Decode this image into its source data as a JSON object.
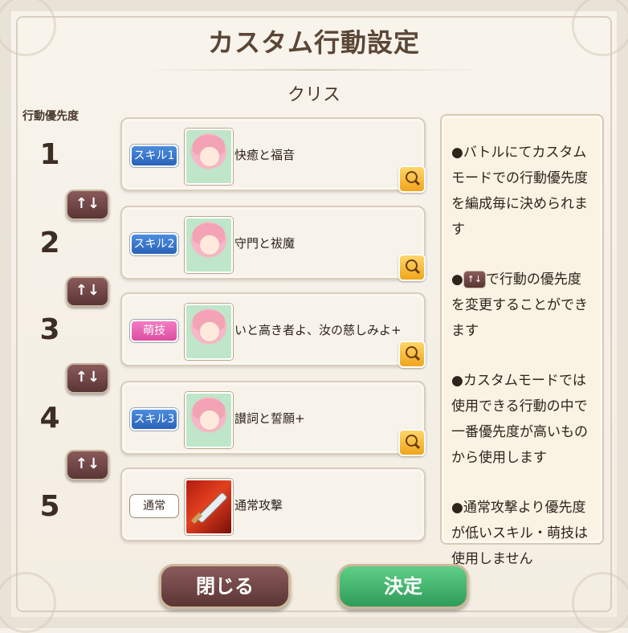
{
  "header": {
    "title": "カスタム行動設定",
    "character_name": "クリス"
  },
  "priority_label": "行動優先度",
  "priorities": [
    "1",
    "2",
    "3",
    "4",
    "5"
  ],
  "actions": [
    {
      "badge": "スキル1",
      "badge_type": "skill",
      "name": "快癒と福音",
      "portrait": "character-portrait"
    },
    {
      "badge": "スキル2",
      "badge_type": "skill",
      "name": "守門と祓魔",
      "portrait": "character-portrait"
    },
    {
      "badge": "萌技",
      "badge_type": "moe",
      "name": "いと高き者よ、汝の慈しみよ+",
      "portrait": "character-portrait"
    },
    {
      "badge": "スキル3",
      "badge_type": "skill",
      "name": "讃詞と誓願+",
      "portrait": "character-portrait"
    },
    {
      "badge": "通常",
      "badge_type": "normal",
      "name": "通常攻撃",
      "portrait": "sword-slash-icon"
    }
  ],
  "swap_label": "↑↓",
  "info": {
    "p1": "●バトルにてカスタムモードでの行動優先度を編成毎に決められます",
    "p2_pre": "●",
    "p2_post": "で行動の優先度を変更することができます",
    "p3": "●カスタムモードでは使用できる行動の中で一番優先度が高いものから使用します",
    "p4": "●通常攻撃より優先度が低いスキル・萌技は使用しません"
  },
  "buttons": {
    "close": "閉じる",
    "confirm": "決定"
  },
  "colors": {
    "skill_badge": "#2a63b8",
    "moe_badge": "#dd4c9f",
    "confirm_button": "#2f9c5a",
    "close_button": "#5b3535",
    "zoom_button": "#f0a51c"
  }
}
